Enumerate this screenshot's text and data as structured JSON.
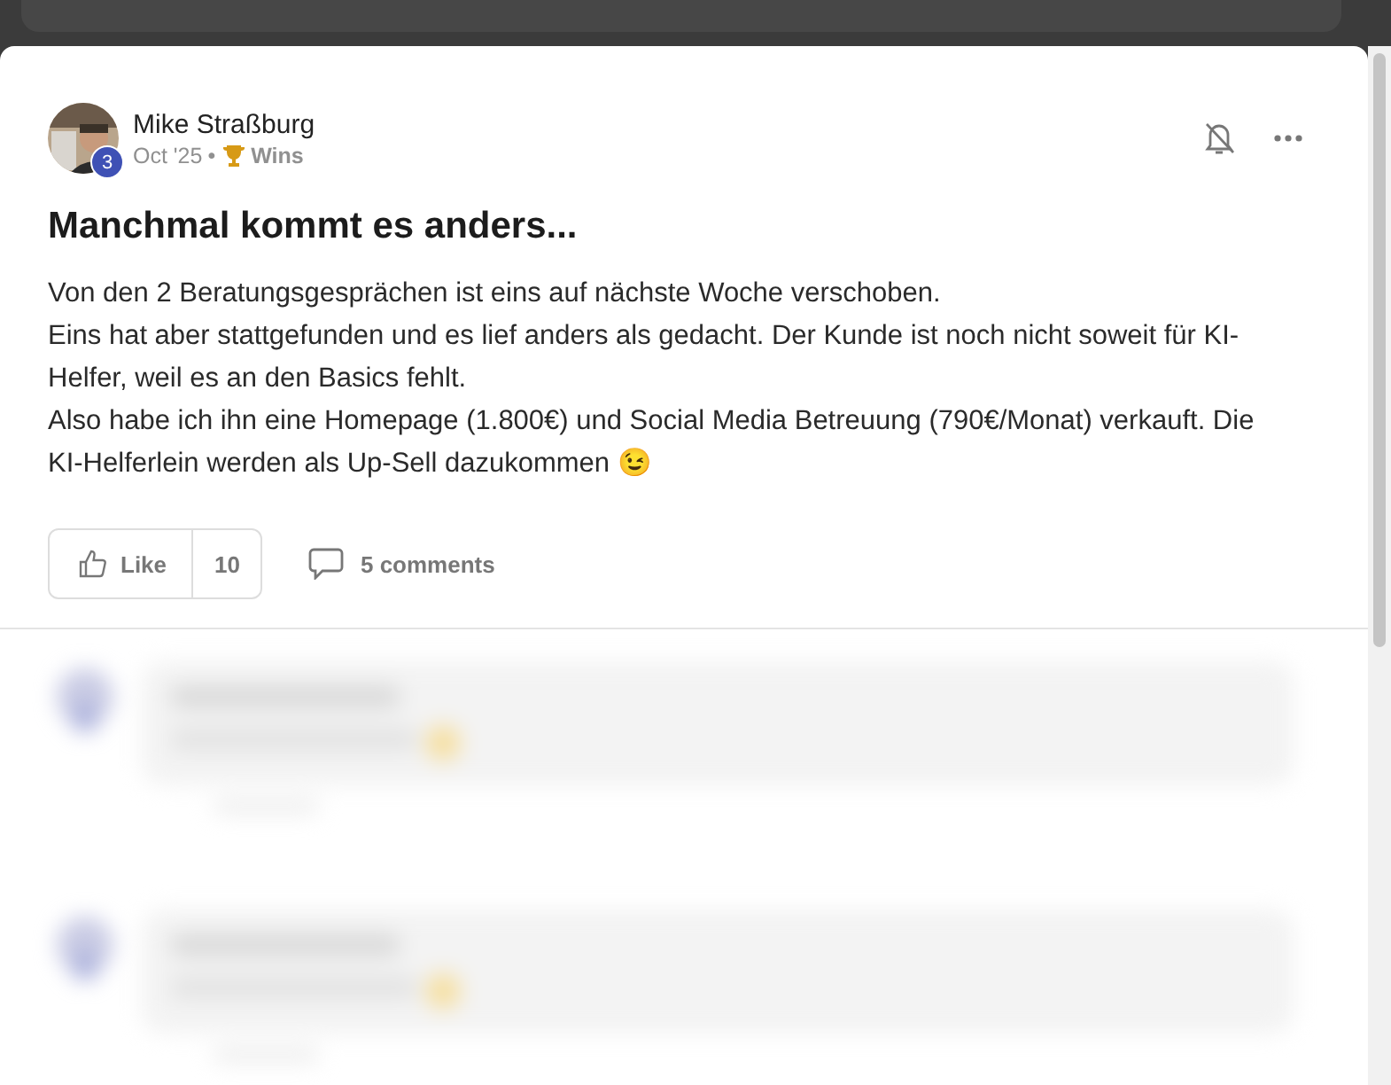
{
  "post": {
    "author": "Mike Straßburg",
    "level_badge": "3",
    "date": "Oct '25",
    "separator": "•",
    "category": "Wins",
    "title": "Manchmal kommt es anders...",
    "paragraphs": [
      "Von den 2 Beratungsgesprächen ist eins auf nächste Woche verschoben.",
      "Eins hat aber stattgefunden und es lief anders als gedacht. Der Kunde ist noch nicht soweit für KI-Helfer, weil es an den Basics fehlt.",
      "Also habe ich ihn eine Homepage (1.800€) und Social Media Betreuung (790€/Monat) verkauft. Die KI-Helferlein werden als Up-Sell dazukommen 😉"
    ],
    "like": {
      "label": "Like",
      "count": "10",
      "selected": false
    },
    "comments_link": "5 comments"
  },
  "comments": [
    {
      "kind": "blurred"
    },
    {
      "kind": "blurred"
    }
  ]
}
